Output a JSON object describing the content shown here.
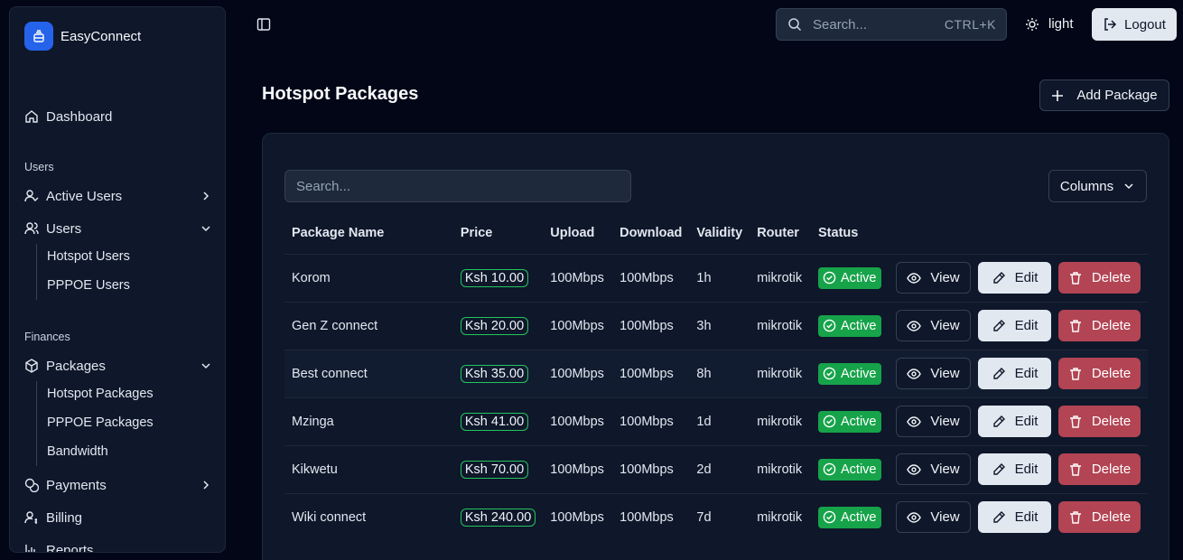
{
  "app": {
    "name": "EasyConnect"
  },
  "sidebar": {
    "dashboard": "Dashboard",
    "section_users": "Users",
    "active_users": "Active Users",
    "users": "Users",
    "hotspot_users": "Hotspot Users",
    "pppoe_users": "PPPOE Users",
    "section_finances": "Finances",
    "packages": "Packages",
    "hotspot_packages": "Hotspot Packages",
    "pppoe_packages": "PPPOE Packages",
    "bandwidth": "Bandwidth",
    "payments": "Payments",
    "billing": "Billing",
    "reports": "Reports"
  },
  "topbar": {
    "search_placeholder": "Search...",
    "search_shortcut": "CTRL+K",
    "theme_label": "light",
    "logout_label": "Logout"
  },
  "page": {
    "title": "Hotspot Packages",
    "add_button": "Add Package"
  },
  "table": {
    "search_placeholder": "Search...",
    "columns_button": "Columns",
    "headers": [
      "Package Name",
      "Price",
      "Upload",
      "Download",
      "Validity",
      "Router",
      "Status"
    ],
    "actions": {
      "view": "View",
      "edit": "Edit",
      "delete": "Delete"
    },
    "rows": [
      {
        "name": "Korom",
        "price": "Ksh 10.00",
        "upload": "100Mbps",
        "download": "100Mbps",
        "validity": "1h",
        "router": "mikrotik",
        "status": "Active"
      },
      {
        "name": "Gen Z connect",
        "price": "Ksh 20.00",
        "upload": "100Mbps",
        "download": "100Mbps",
        "validity": "3h",
        "router": "mikrotik",
        "status": "Active"
      },
      {
        "name": "Best connect",
        "price": "Ksh 35.00",
        "upload": "100Mbps",
        "download": "100Mbps",
        "validity": "8h",
        "router": "mikrotik",
        "status": "Active"
      },
      {
        "name": "Mzinga",
        "price": "Ksh 41.00",
        "upload": "100Mbps",
        "download": "100Mbps",
        "validity": "1d",
        "router": "mikrotik",
        "status": "Active"
      },
      {
        "name": "Kikwetu",
        "price": "Ksh 70.00",
        "upload": "100Mbps",
        "download": "100Mbps",
        "validity": "2d",
        "router": "mikrotik",
        "status": "Active"
      },
      {
        "name": "Wiki connect",
        "price": "Ksh 240.00",
        "upload": "100Mbps",
        "download": "100Mbps",
        "validity": "7d",
        "router": "mikrotik",
        "status": "Active"
      }
    ]
  },
  "colors": {
    "background": "#020617",
    "surface": "#0f172a",
    "accent": "#2563eb",
    "active": "#16a34a",
    "price_border": "#22c55e",
    "delete": "#b24453"
  }
}
